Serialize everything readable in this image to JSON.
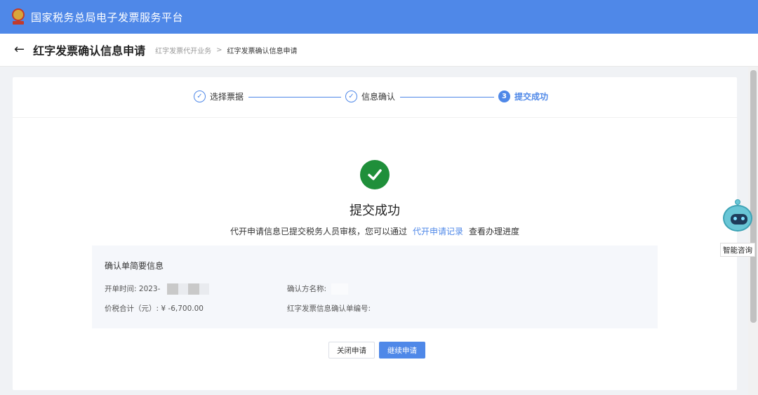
{
  "app": {
    "title": "国家税务总局电子发票服务平台"
  },
  "header": {
    "title": "红字发票确认信息申请",
    "breadcrumb": [
      "红字发票代开业务",
      "红字发票确认信息申请"
    ],
    "breadcrumb_sep": ">"
  },
  "steps": [
    {
      "label": "选择票据",
      "marker": "✓"
    },
    {
      "label": "信息确认",
      "marker": "✓"
    },
    {
      "label": "提交成功",
      "marker": "3"
    }
  ],
  "result": {
    "title": "提交成功",
    "message_before": "代开申请信息已提交税务人员审核，您可以通过",
    "link": "代开申请记录",
    "message_after": "查看办理进度"
  },
  "summary": {
    "title": "确认单简要信息",
    "open_time_label": "开单时间:",
    "open_time_value": "2023-",
    "confirm_party_label": "确认方名称:",
    "total_label": "价税合计（元）:",
    "total_value": "¥ -6,700.00",
    "confirm_no_label": "红字发票信息确认单编号:"
  },
  "buttons": {
    "close": "关闭申请",
    "continue": "继续申请"
  },
  "assistant": {
    "label": "智能咨询"
  },
  "colors": {
    "primary": "#4f88e8",
    "success": "#1f8f3a",
    "summary_bg": "#f5f7fb"
  }
}
